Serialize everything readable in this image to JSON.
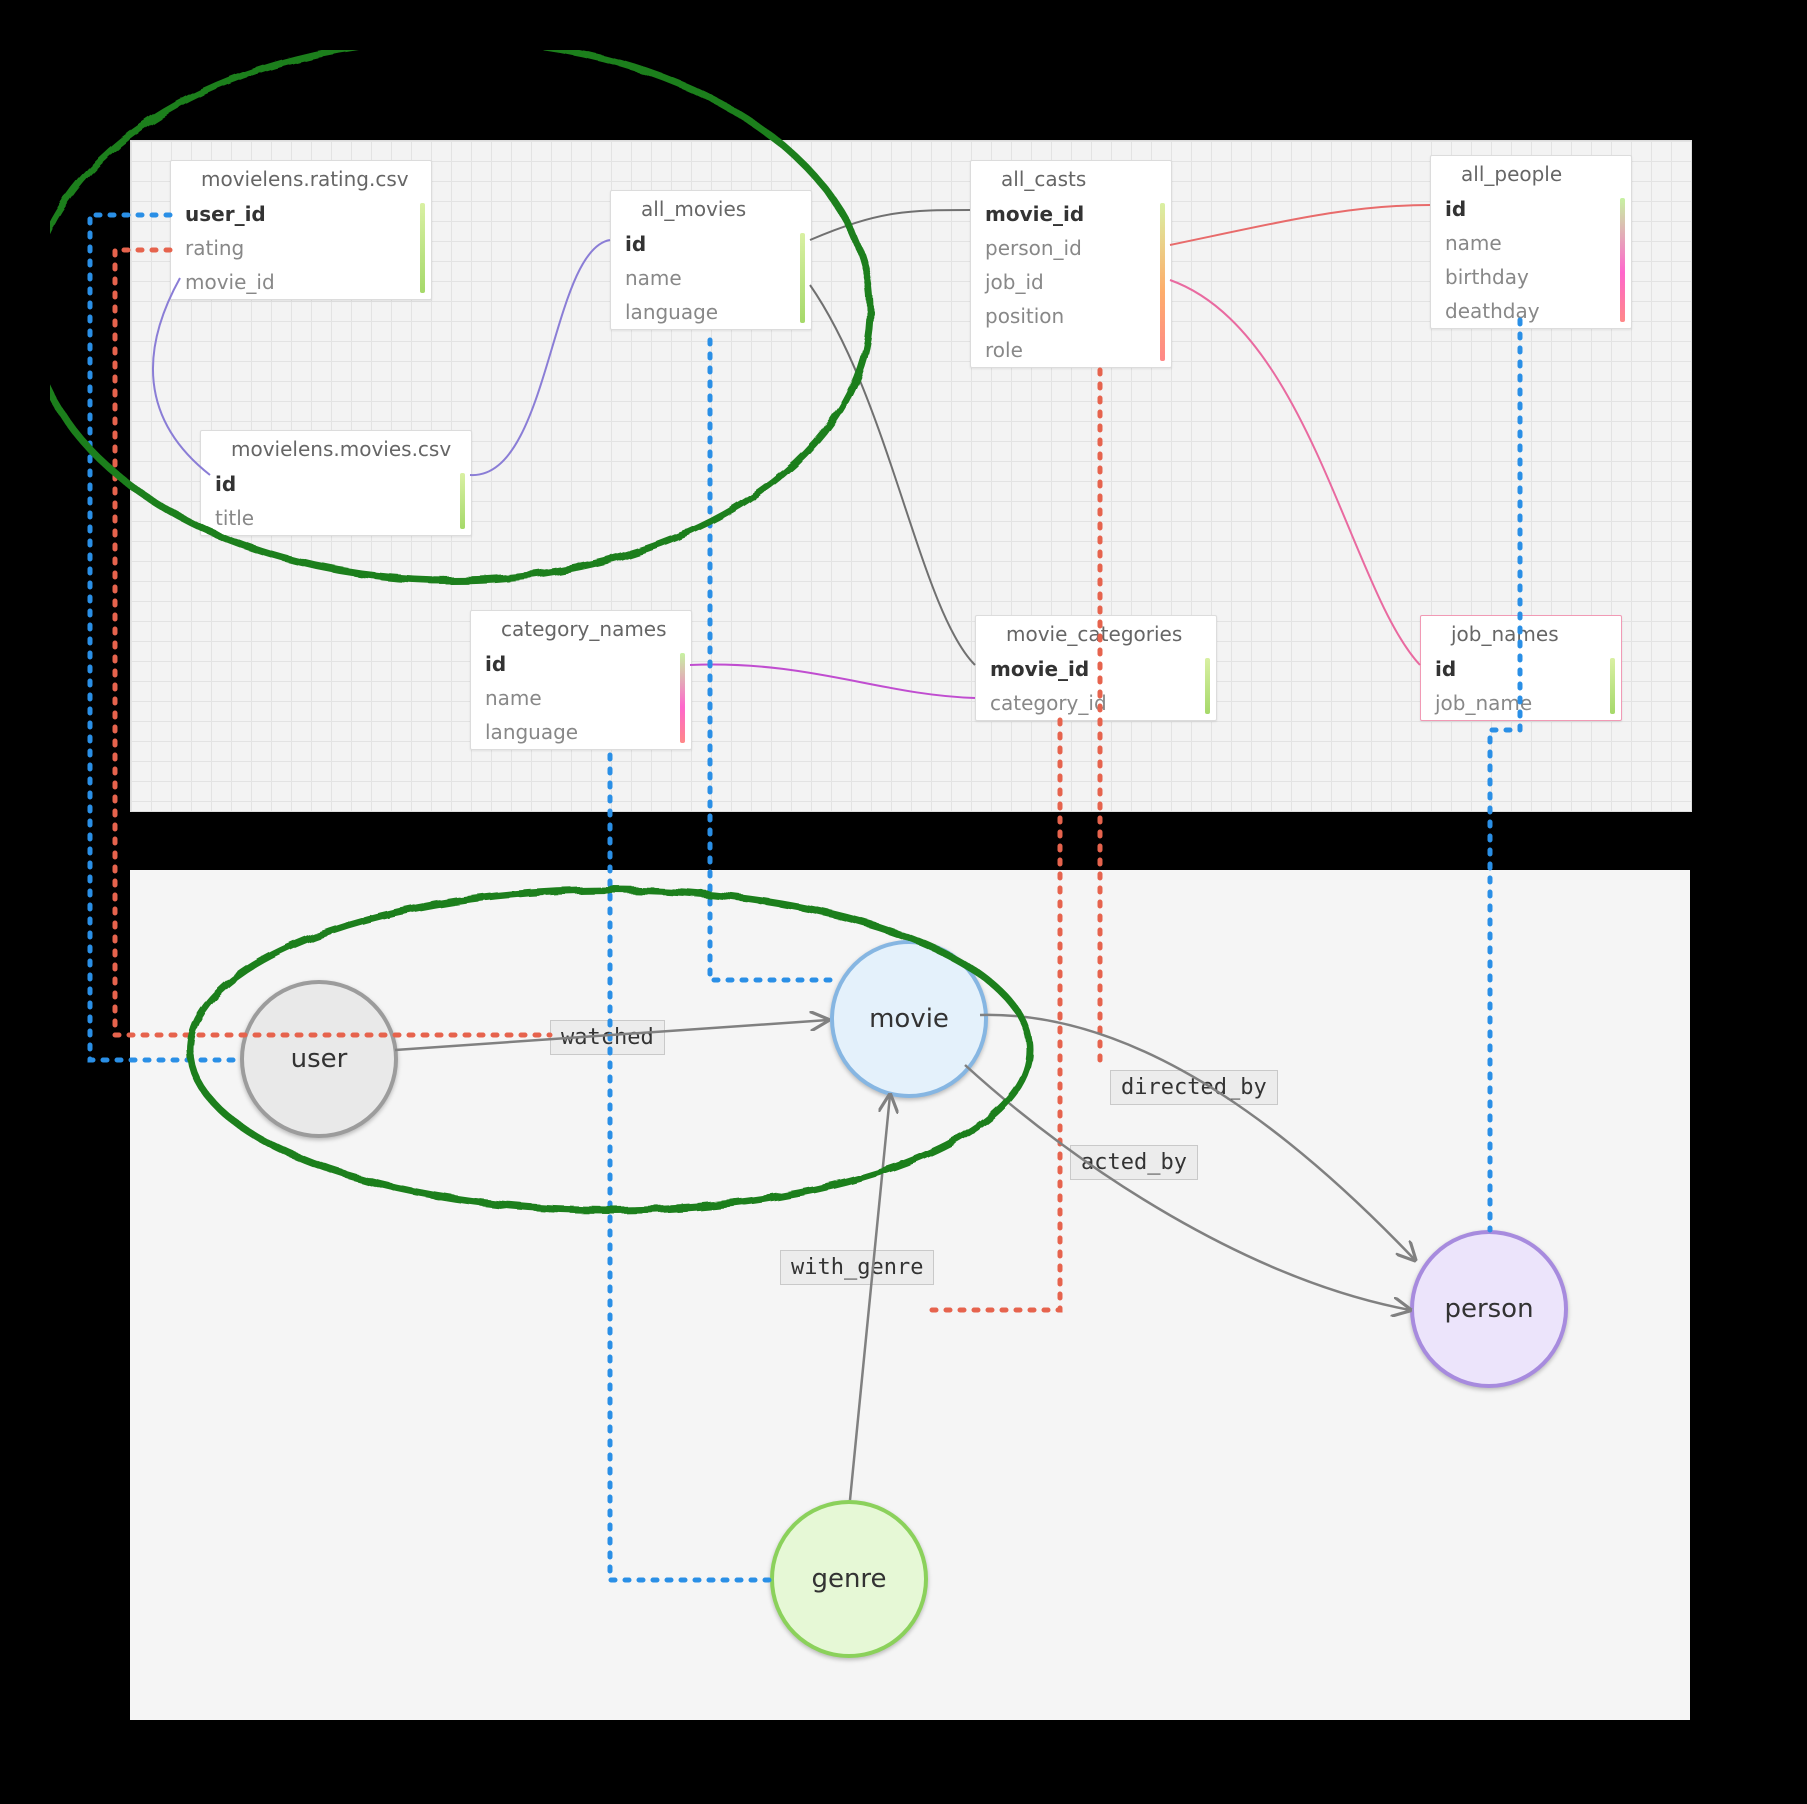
{
  "tables": {
    "rating": {
      "title": "movielens.rating.csv",
      "fields": [
        "user_id",
        "rating",
        "movie_id"
      ],
      "key": "user_id"
    },
    "movies_csv": {
      "title": "movielens.movies.csv",
      "fields": [
        "id",
        "title"
      ],
      "key": "id"
    },
    "all_movies": {
      "title": "all_movies",
      "fields": [
        "id",
        "name",
        "language"
      ],
      "key": "id"
    },
    "all_casts": {
      "title": "all_casts",
      "fields": [
        "movie_id",
        "person_id",
        "job_id",
        "position",
        "role"
      ],
      "key": "movie_id"
    },
    "all_people": {
      "title": "all_people",
      "fields": [
        "id",
        "name",
        "birthday",
        "deathday"
      ],
      "key": "id"
    },
    "category_names": {
      "title": "category_names",
      "fields": [
        "id",
        "name",
        "language"
      ],
      "key": "id"
    },
    "movie_categories": {
      "title": "movie_categories",
      "fields": [
        "movie_id",
        "category_id"
      ],
      "key": "movie_id"
    },
    "job_names": {
      "title": "job_names",
      "fields": [
        "id",
        "job_name"
      ],
      "key": "id"
    }
  },
  "nodes": {
    "user": "user",
    "movie": "movie",
    "genre": "genre",
    "person": "person"
  },
  "edges": {
    "watched": "watched",
    "with_genre": "with_genre",
    "directed_by": "directed_by",
    "acted_by": "acted_by"
  }
}
